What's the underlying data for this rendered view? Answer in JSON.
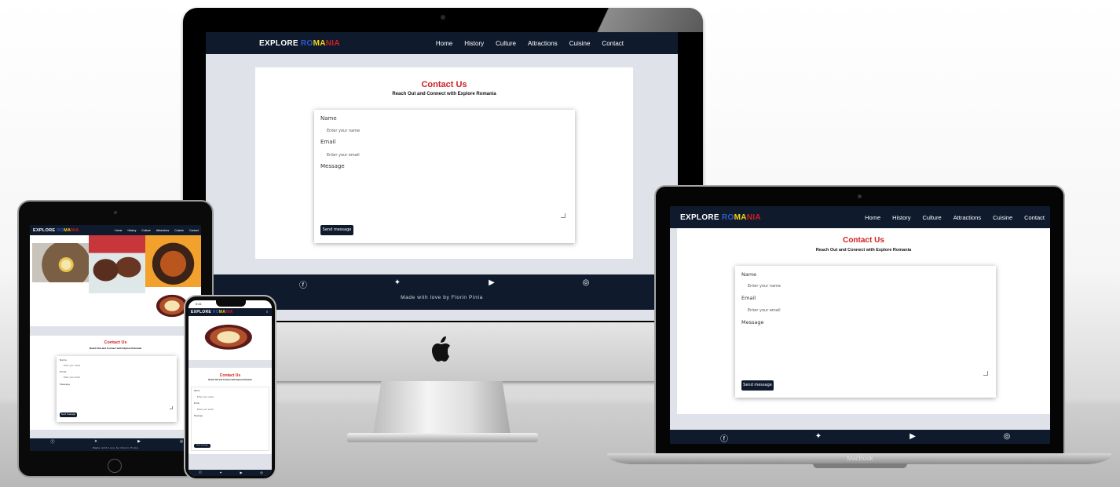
{
  "site": {
    "brand_prefix": "EXPLORE ",
    "brand_r": "RO",
    "brand_y": "MA",
    "brand_rd": "NIA",
    "nav": [
      "Home",
      "History",
      "Culture",
      "Attractions",
      "Cuisine",
      "Contact"
    ],
    "contact_title": "Contact Us",
    "contact_subtitle": "Reach Out and Connect with Explore Romania",
    "name_label": "Name",
    "name_placeholder": "Enter your name",
    "email_label": "Email",
    "email_placeholder": "Enter your email",
    "message_label": "Message",
    "send_button": "Send message",
    "footer_text": "Made with love by Florin Pinta",
    "social_icons": [
      "facebook-icon",
      "twitter-icon",
      "youtube-icon",
      "instagram-icon"
    ]
  },
  "laptop_label": "MacBook",
  "phone_time": "9:41",
  "colors": {
    "nav_bg": "#0f1b2d",
    "title_red": "#cf1f20",
    "brand_blue": "#2f59c9",
    "brand_yellow": "#f5d410",
    "brand_red": "#d11f26"
  }
}
